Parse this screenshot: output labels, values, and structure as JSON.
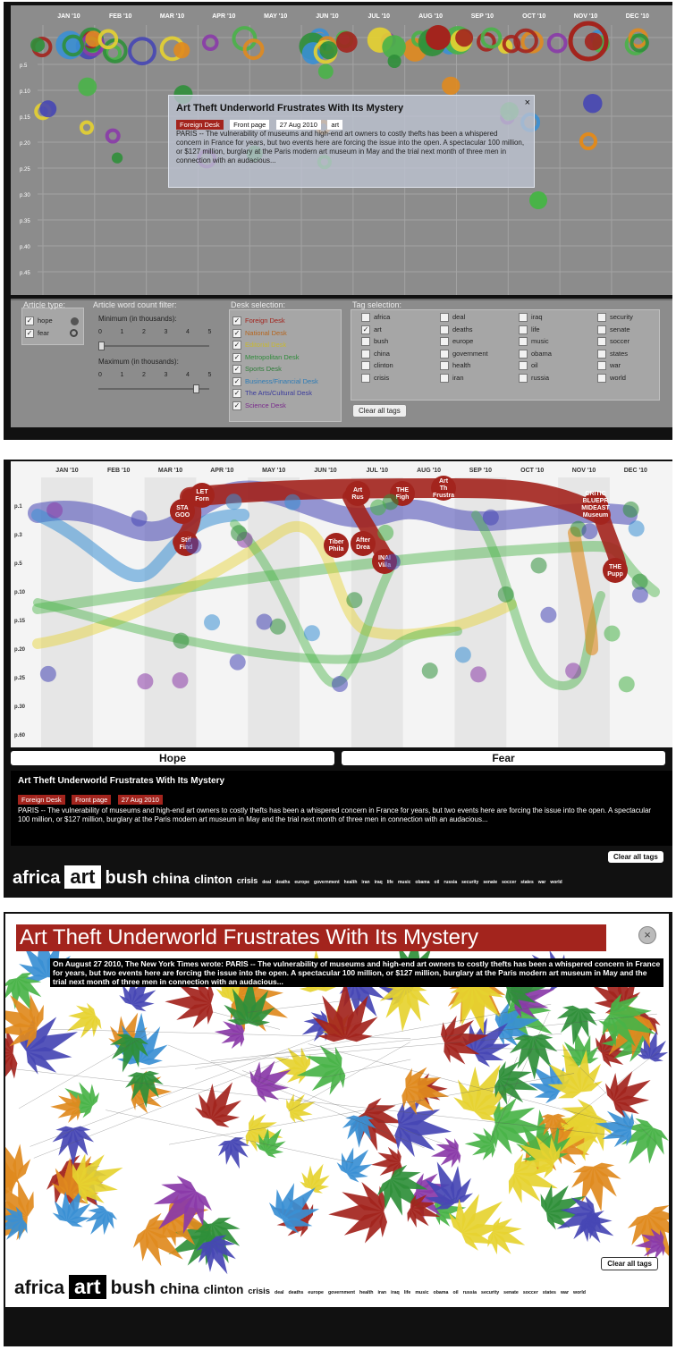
{
  "months": [
    "JAN '10",
    "FEB '10",
    "MAR '10",
    "APR '10",
    "MAY '10",
    "JUN '10",
    "JUL '10",
    "AUG '10",
    "SEP '10",
    "OCT '10",
    "NOV '10",
    "DEC '10"
  ],
  "panel1": {
    "y_ticks": [
      "p.5",
      "p.10",
      "p.15",
      "p.20",
      "p.25",
      "p.30",
      "p.35",
      "p.40",
      "p.45"
    ],
    "controls": {
      "article_type_label": "Article type:",
      "hope": "hope",
      "fear": "fear",
      "word_count_label": "Article word count filter:",
      "minimum_label": "Minimum (in thousands):",
      "maximum_label": "Maximum (in thousands):",
      "scale": [
        "0",
        "1",
        "2",
        "3",
        "4",
        "5"
      ],
      "desk_label": "Desk selection:",
      "desks": [
        {
          "name": "Foreign Desk",
          "color": "#a3241d"
        },
        {
          "name": "National Desk",
          "color": "#b5651d"
        },
        {
          "name": "Editorial Desk",
          "color": "#c8b830"
        },
        {
          "name": "Metropolitan Desk",
          "color": "#2e8b3a"
        },
        {
          "name": "Sports Desk",
          "color": "#2f7d3a"
        },
        {
          "name": "Business/Financial Desk",
          "color": "#2c7bb6"
        },
        {
          "name": "The Arts/Cultural Desk",
          "color": "#3b3b9c"
        },
        {
          "name": "Science Desk",
          "color": "#7a2b8c"
        }
      ],
      "tag_label": "Tag selection:",
      "tag_columns": [
        [
          "africa",
          "art",
          "bush",
          "china",
          "clinton",
          "crisis"
        ],
        [
          "deal",
          "deaths",
          "europe",
          "government",
          "health",
          "iran"
        ],
        [
          "iraq",
          "life",
          "music",
          "obama",
          "oil",
          "russia"
        ],
        [
          "security",
          "senate",
          "soccer",
          "states",
          "war",
          "world"
        ]
      ],
      "clear_all_tags": "Clear all tags"
    },
    "popup": {
      "title": "Art Theft Underworld Frustrates With Its Mystery",
      "desk": "Foreign Desk",
      "page": "Front page",
      "date": "27 Aug 2010",
      "tag": "art",
      "close": "×",
      "body": "PARIS -- The vulnerability of museums and high-end art owners to costly thefts has been a whispered concern in France for years, but two events here are forcing the issue into the open. A spectacular 100 million, or $127 million, burglary at the Paris modern art museum in May and the trial next month of three men in connection with an audacious..."
    }
  },
  "panel2": {
    "y_ticks": [
      "p.1",
      "p.3",
      "p.5",
      "p.10",
      "p.15",
      "p.20",
      "p.25",
      "p.30",
      "p.60"
    ],
    "hope": "Hope",
    "fear": "Fear",
    "detail": {
      "title": "Art Theft Underworld Frustrates With Its Mystery",
      "desk": "Foreign Desk",
      "page": "Front page",
      "date": "27 Aug 2010",
      "body": "PARIS -- The vulnerability of museums and high-end art owners to costly thefts has been a whispered concern in France for years, but two events here are forcing the issue into the open. A spectacular 100 million, or $127 million, burglary at the Paris modern art museum in May and the trial next month of three men in connection with an audacious..."
    },
    "clear_all_tags": "Clear all tags",
    "bubble_labels": {
      "foreign_top": "LET Forn",
      "sta": "STA GOO",
      "stif": "Stif Find",
      "art1": "Art Rus",
      "the": "THE Figh",
      "art2": "Art Th Frustra",
      "critic": "CRITIC BLUEPR MIDEAST Museum",
      "tiber": "Tiber Phila",
      "after": "After Drea",
      "inai": "INAI Villa",
      "the_pupp": "THE Pupp"
    }
  },
  "tags": [
    {
      "name": "africa",
      "size": 20
    },
    {
      "name": "art",
      "size": 22,
      "selected": true
    },
    {
      "name": "bush",
      "size": 20
    },
    {
      "name": "china",
      "size": 16
    },
    {
      "name": "clinton",
      "size": 13
    },
    {
      "name": "crisis",
      "size": 9
    },
    {
      "name": "deal",
      "size": 5
    },
    {
      "name": "deaths",
      "size": 5
    },
    {
      "name": "europe",
      "size": 5
    },
    {
      "name": "government",
      "size": 5
    },
    {
      "name": "health",
      "size": 5
    },
    {
      "name": "iran",
      "size": 5
    },
    {
      "name": "iraq",
      "size": 5
    },
    {
      "name": "life",
      "size": 5
    },
    {
      "name": "music",
      "size": 5
    },
    {
      "name": "obama",
      "size": 5
    },
    {
      "name": "oil",
      "size": 5
    },
    {
      "name": "russia",
      "size": 5
    },
    {
      "name": "security",
      "size": 5
    },
    {
      "name": "senate",
      "size": 5
    },
    {
      "name": "soccer",
      "size": 5
    },
    {
      "name": "states",
      "size": 5
    },
    {
      "name": "war",
      "size": 5
    },
    {
      "name": "world",
      "size": 5
    }
  ],
  "panel3": {
    "title": "Art Theft Underworld Frustrates With Its Mystery",
    "close": "×",
    "description": "On August 27 2010, The New York Times wrote:  PARIS -- The vulnerability of museums and high-end art owners to costly thefts has been a whispered concern in France for years, but two events here are forcing the issue into the open. A spectacular 100 million, or $127 million, burglary at the Paris modern art museum in May and the trial next month of three men in connection with an audacious...",
    "clear_all_tags": "Clear all tags"
  },
  "colors": {
    "foreign": "#a3241d",
    "national": "#e08a1e",
    "editorial": "#e6d230",
    "metro": "#49b348",
    "sports": "#2f8f3a",
    "business": "#3a8fd4",
    "arts": "#4646b4",
    "science": "#8a3aa8"
  }
}
